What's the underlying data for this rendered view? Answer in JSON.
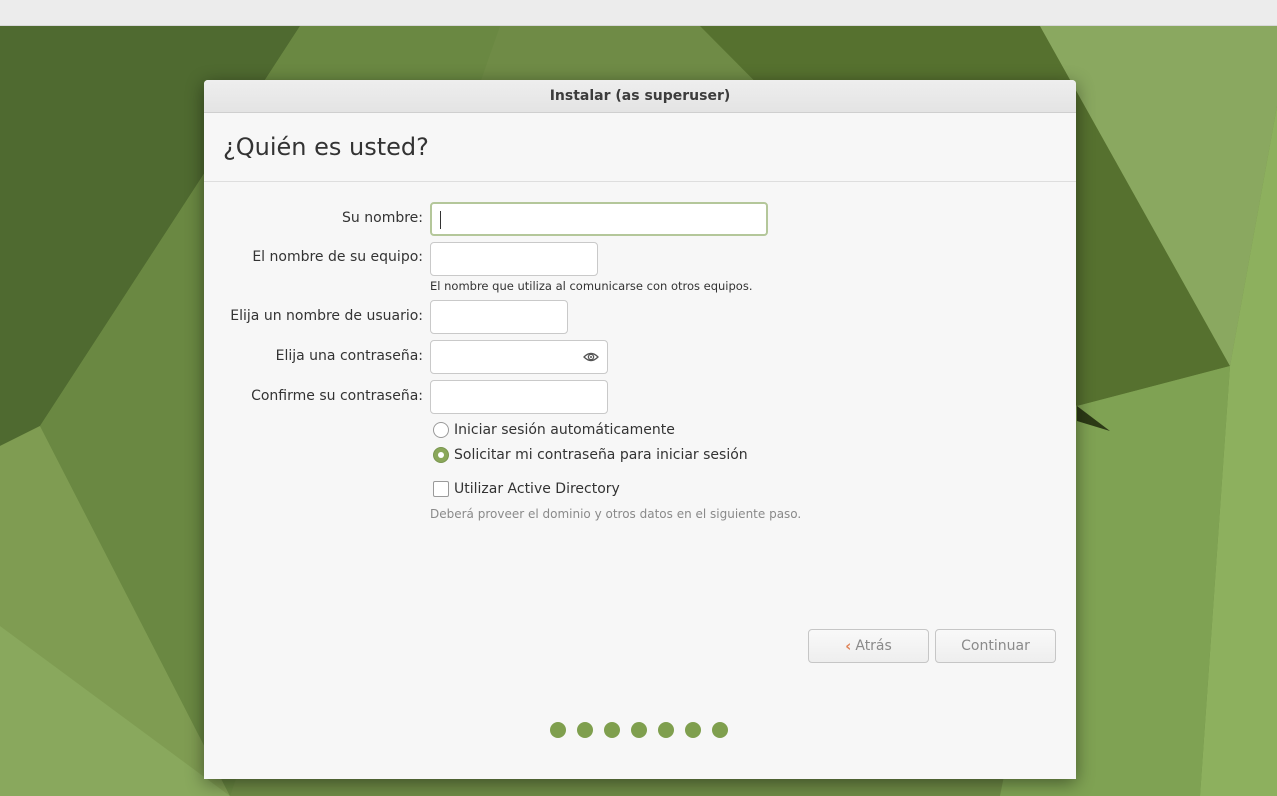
{
  "window": {
    "title": "Instalar (as superuser)"
  },
  "page": {
    "heading": "¿Quién es usted?"
  },
  "form": {
    "name_label": "Su nombre:",
    "name_value": "",
    "computer_label": "El nombre de su equipo:",
    "computer_value": "",
    "computer_hint": "El nombre que utiliza al comunicarse con otros equipos.",
    "username_label": "Elija un nombre de usuario:",
    "username_value": "",
    "password_label": "Elija una contraseña:",
    "password_value": "",
    "confirm_label": "Confirme su contraseña:",
    "confirm_value": ""
  },
  "options": {
    "auto_login_label": "Iniciar sesión automáticamente",
    "auto_login_selected": false,
    "require_password_label": "Solicitar mi contraseña para iniciar sesión",
    "require_password_selected": true,
    "active_directory_label": "Utilizar Active Directory",
    "active_directory_checked": false,
    "active_directory_hint": "Deberá proveer el dominio y otros datos en el siguiente paso."
  },
  "buttons": {
    "back_label": "Atrás",
    "continue_label": "Continuar"
  },
  "progress": {
    "total_steps": 7
  },
  "icons": {
    "back": "chevron-left-icon",
    "reveal": "eye-icon"
  },
  "colors": {
    "accent": "#8aa75a",
    "back_arrow": "#e0855a",
    "desktop": "#6e8a45"
  }
}
